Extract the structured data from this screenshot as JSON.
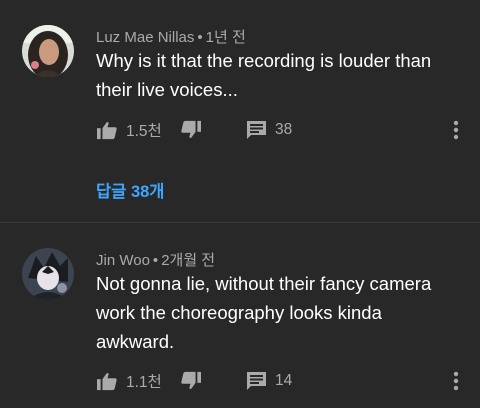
{
  "comments": [
    {
      "author": "Luz Mae Nillas",
      "separator": "•",
      "time": "1년 전",
      "text": "Why is it that the recording is louder than their live voices...",
      "likes": "1.5천",
      "reply_count": "38",
      "replies_link": "답글 38개",
      "avatar_icon": "profile-photo-woman"
    },
    {
      "author": "Jin Woo",
      "separator": "•",
      "time": "2개월 전",
      "text": "Not gonna lie, without their fancy camera work the choreography looks kinda awkward.",
      "likes": "1.1천",
      "reply_count": "14",
      "avatar_icon": "profile-photo-anime"
    }
  ],
  "icons": {
    "like": "thumbs-up-icon",
    "dislike": "thumbs-down-icon",
    "reply": "comment-icon",
    "more": "more-vert-icon"
  },
  "colors": {
    "background": "#282828",
    "text": "#ffffff",
    "meta": "#aaaaaa",
    "link": "#3ea6ff"
  }
}
